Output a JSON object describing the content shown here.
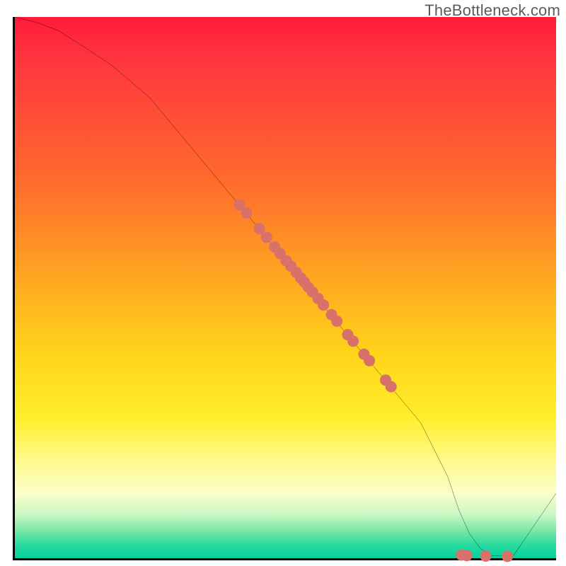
{
  "watermark": "TheBottleneck.com",
  "chart_data": {
    "type": "line",
    "title": "",
    "xlabel": "",
    "ylabel": "",
    "xlim": [
      0,
      100
    ],
    "ylim": [
      0,
      100
    ],
    "curve": {
      "x": [
        0,
        4,
        8,
        12,
        18,
        25,
        35,
        45,
        55,
        65,
        75,
        80,
        82,
        84,
        86,
        88,
        92,
        100
      ],
      "y": [
        100,
        99,
        97.5,
        95,
        91,
        85,
        73,
        61,
        49,
        37,
        25,
        15,
        9,
        4.5,
        1.8,
        0.5,
        0.3,
        12
      ]
    },
    "series": [
      {
        "name": "cluster-on-line",
        "color": "#d9716b",
        "x": [
          41.5,
          42.8,
          45.2,
          46.5,
          48.0,
          49.0,
          50.1,
          51.0,
          52.0,
          52.8,
          53.5,
          54.2,
          55.0,
          56.0,
          57.0,
          58.5,
          59.5,
          61.5,
          62.5,
          64.5,
          65.5,
          68.5,
          69.5
        ],
        "y": [
          65.3,
          63.8,
          60.9,
          59.3,
          57.5,
          56.3,
          55.0,
          54.0,
          52.8,
          51.8,
          51.0,
          50.1,
          49.2,
          48.0,
          46.8,
          45.0,
          43.8,
          41.3,
          40.1,
          37.7,
          36.5,
          32.9,
          31.7
        ]
      },
      {
        "name": "cluster-bottom",
        "color": "#d9716b",
        "x": [
          82.5,
          83.5,
          87.0,
          91.0
        ],
        "y": [
          0.6,
          0.5,
          0.4,
          0.35
        ]
      }
    ]
  }
}
